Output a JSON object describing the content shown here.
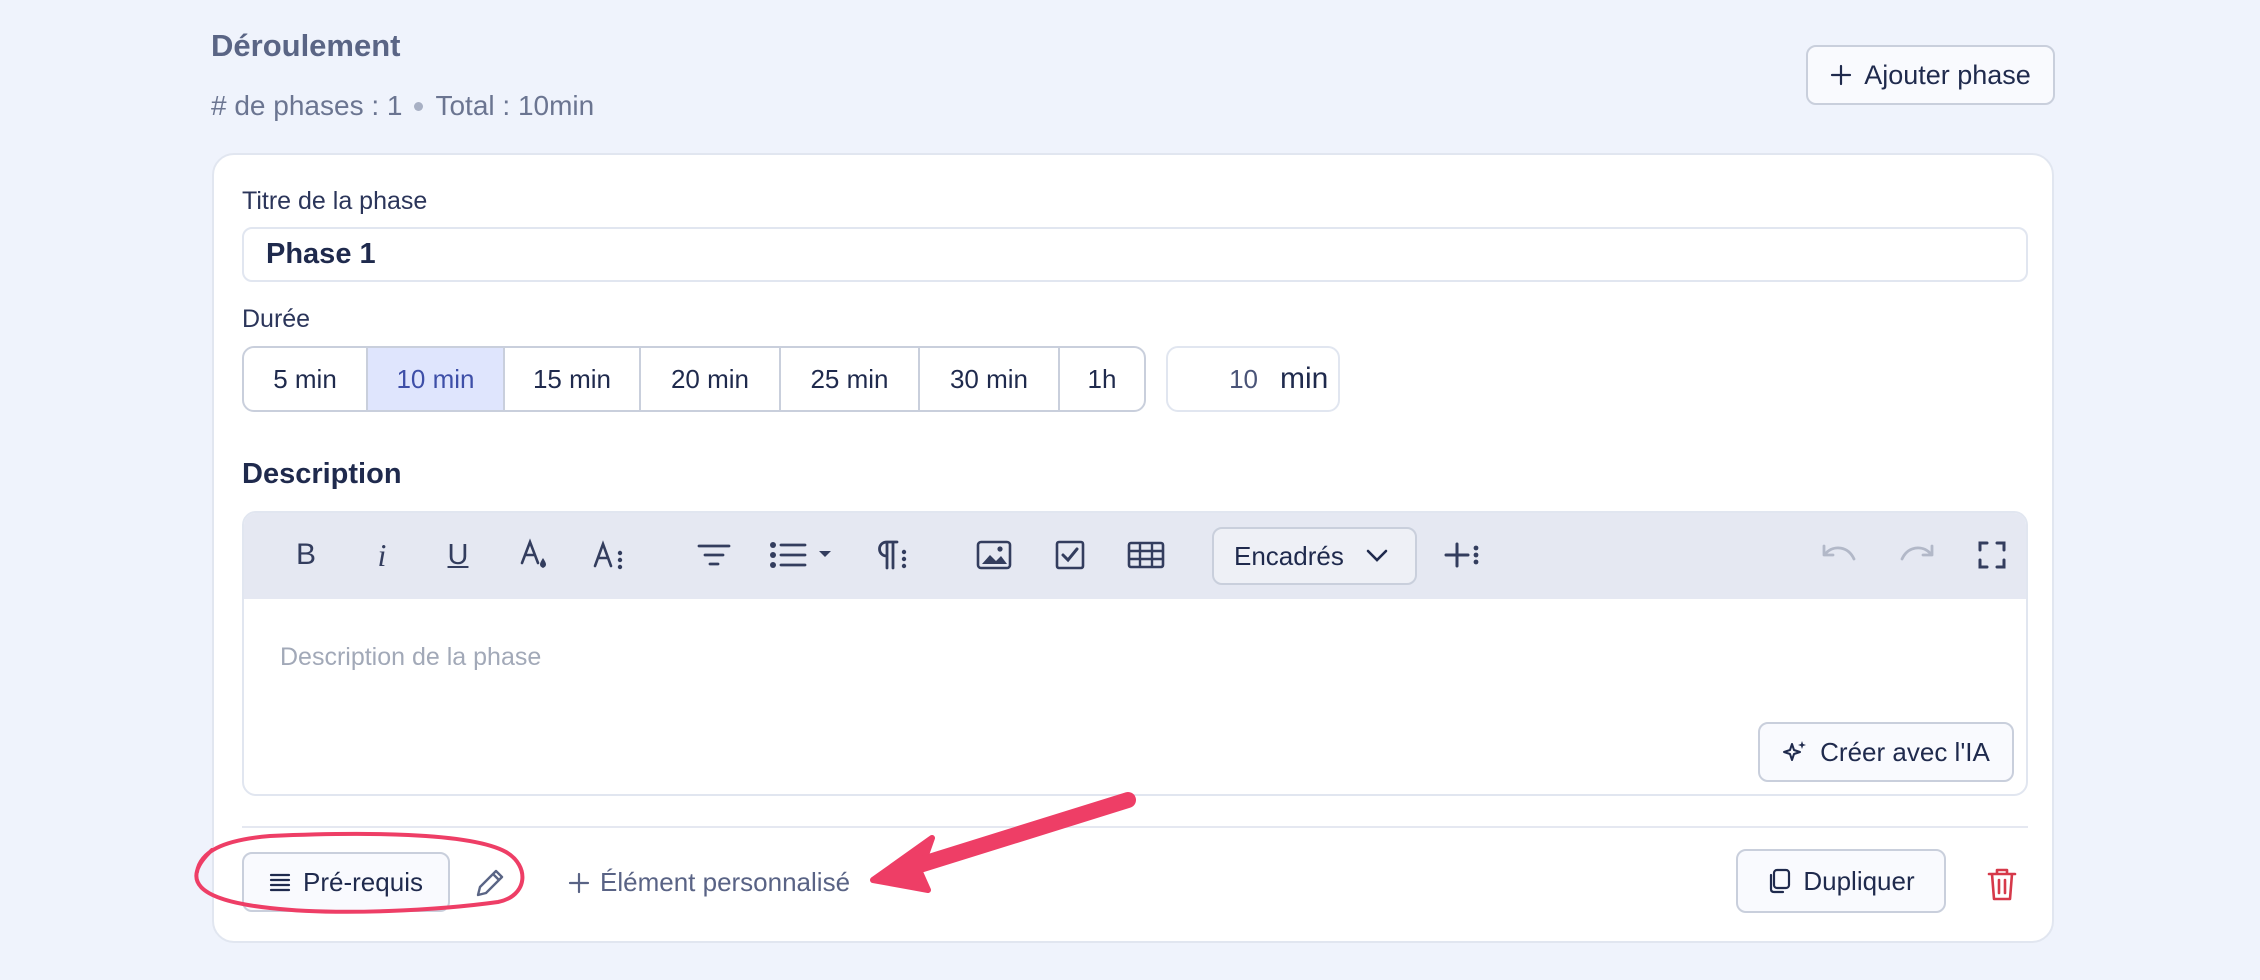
{
  "section": {
    "title": "Déroulement",
    "phase_count": "# de phases : 1",
    "total": "Total : 10min",
    "add_phase_label": "Ajouter phase"
  },
  "phase": {
    "title_label": "Titre de la phase",
    "title_value": "Phase 1",
    "duration_label": "Durée",
    "duration_options": [
      "5 min",
      "10 min",
      "15 min",
      "20 min",
      "25 min",
      "30 min",
      "1h"
    ],
    "duration_selected": "10 min",
    "custom_duration_value": "10",
    "custom_duration_unit": "min",
    "description_label": "Description",
    "description_placeholder": "Description de la phase",
    "toolbar": {
      "tools": [
        "bold-icon",
        "italic-icon",
        "underline-icon",
        "text-color-icon",
        "font-size-icon",
        "align-icon",
        "bullet-list-icon",
        "paragraph-icon",
        "image-icon",
        "checkbox-icon",
        "table-icon"
      ],
      "encadres_label": "Encadrés",
      "extra_tools": [
        "insert-more-icon",
        "undo-icon",
        "redo-icon",
        "fullscreen-icon"
      ]
    },
    "ai_button_label": "Créer avec l'IA",
    "prerequisites_label": "Pré-requis",
    "custom_element_label": "Élément personnalisé",
    "duplicate_label": "Dupliquer"
  },
  "colors": {
    "background": "#eff3fc",
    "selected_duration": "#dfe5fd",
    "annotation": "#ee3e66",
    "delete": "#d6394a"
  }
}
